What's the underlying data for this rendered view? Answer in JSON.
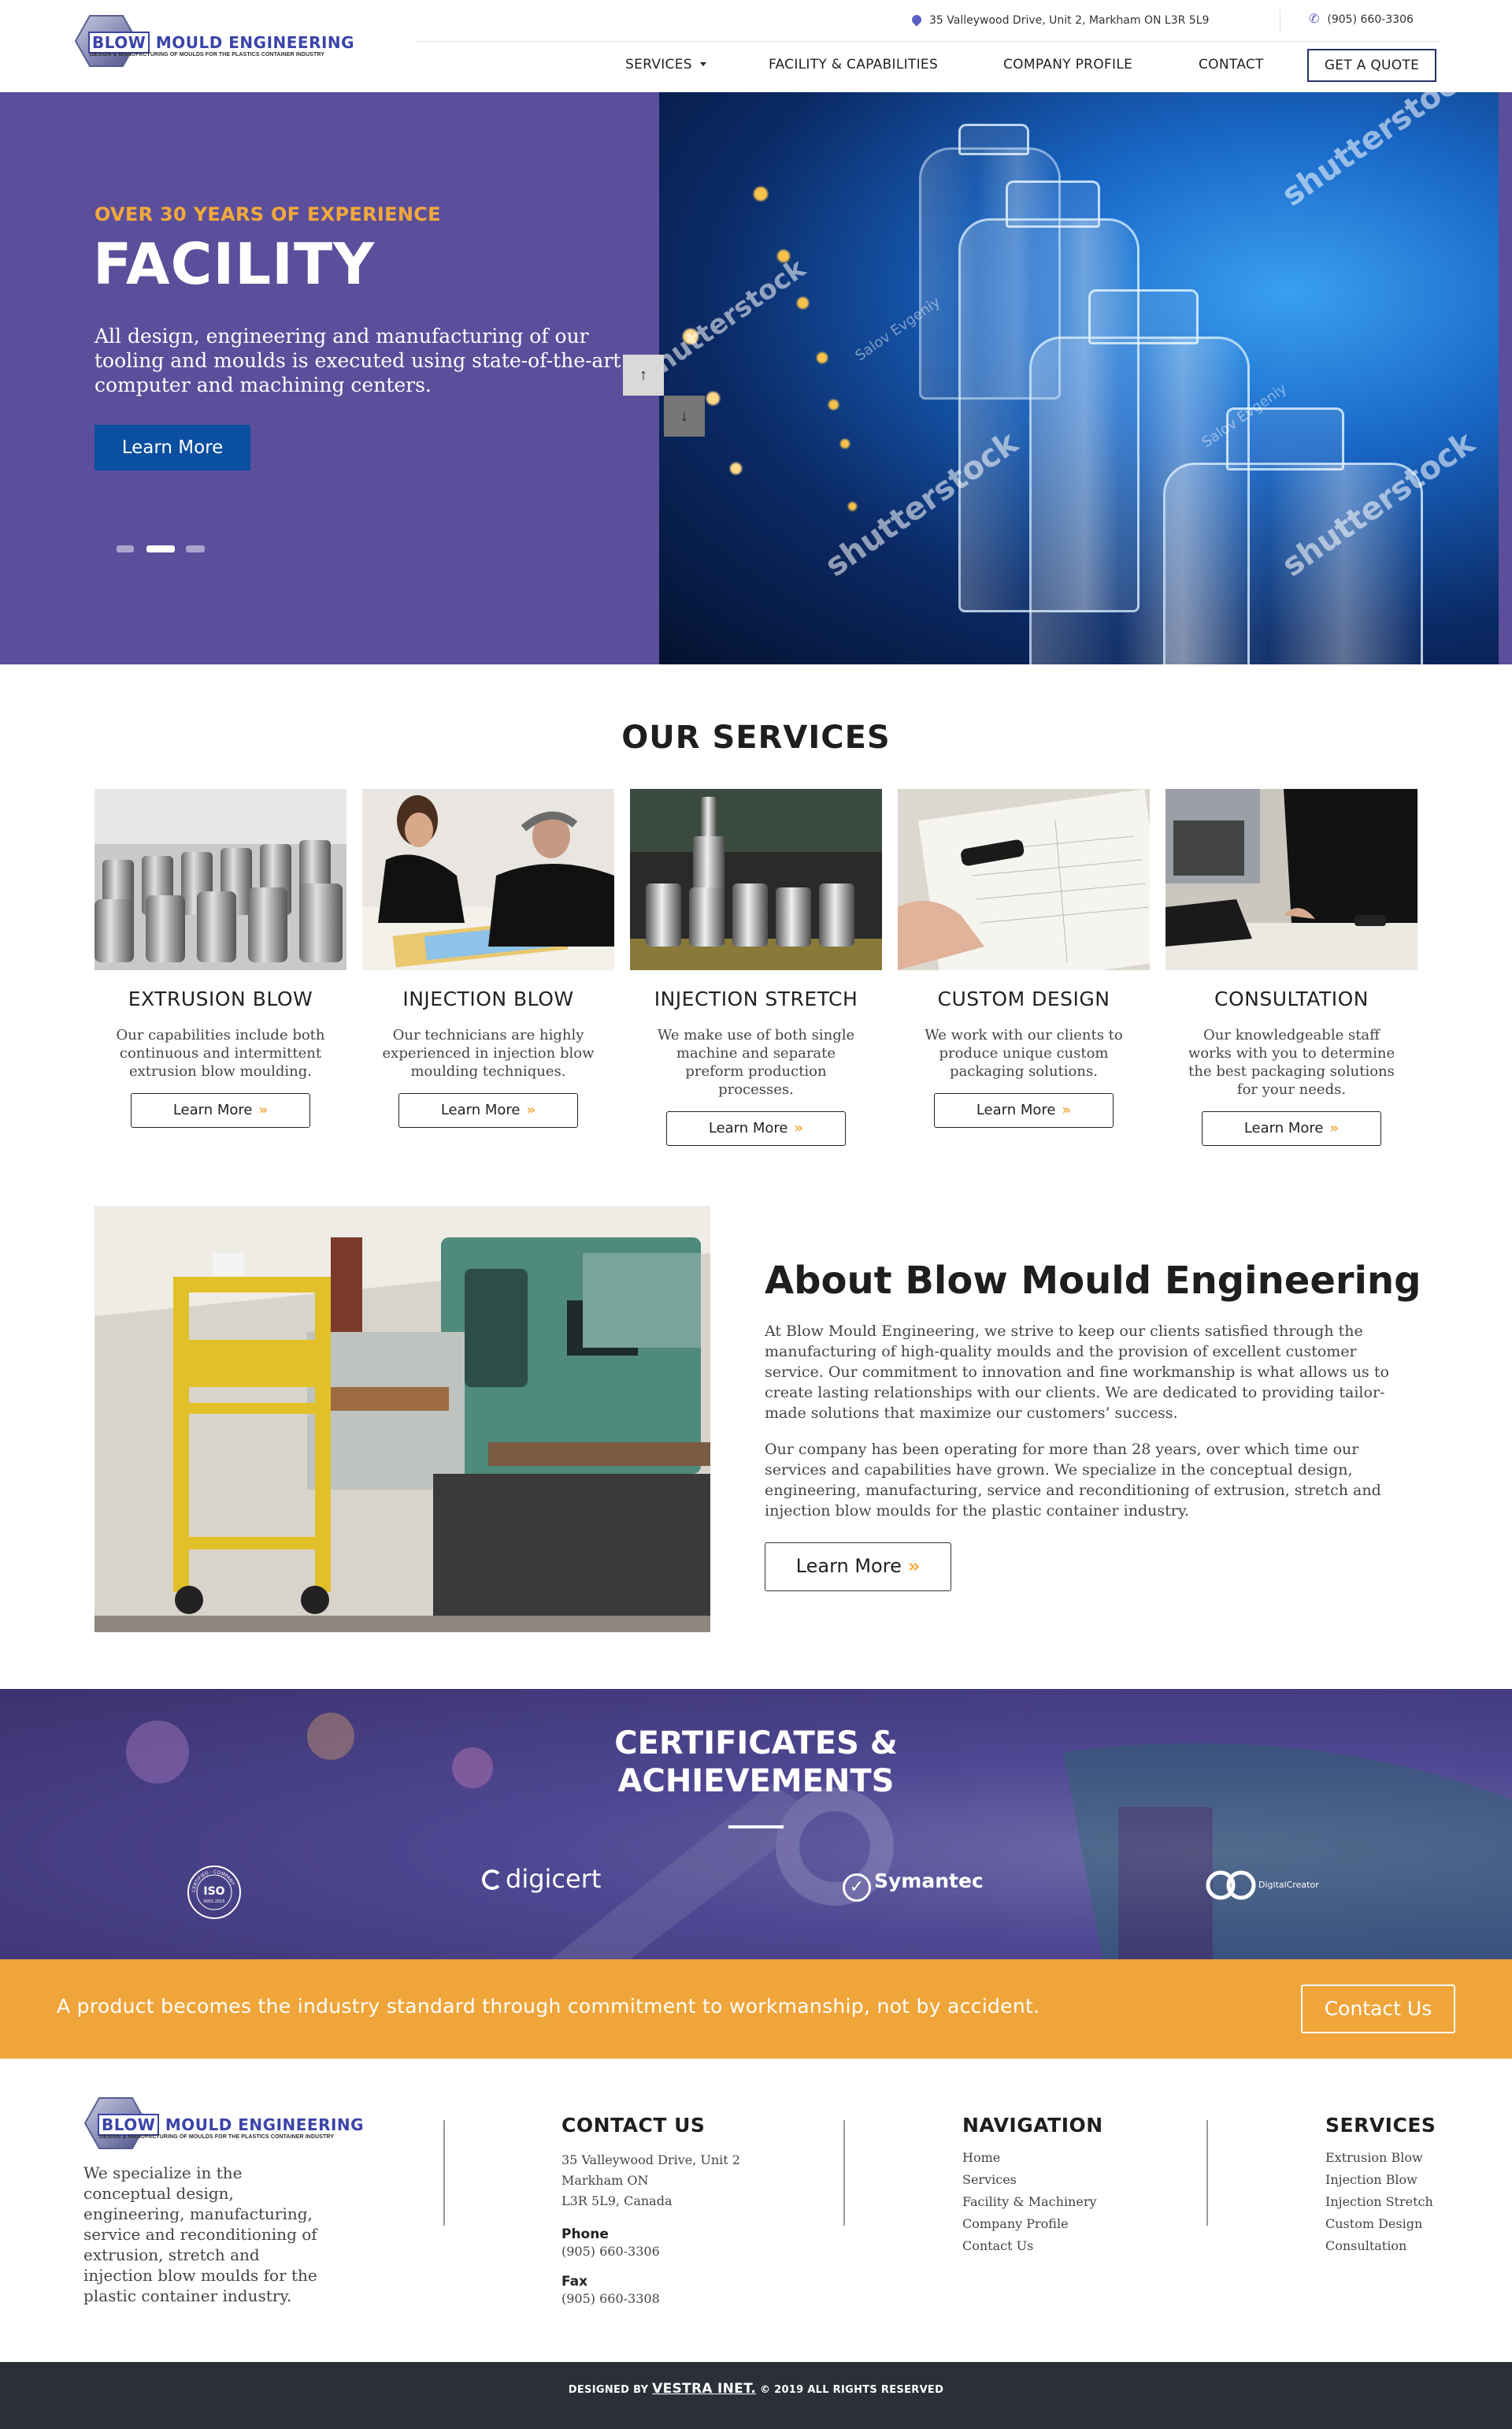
{
  "header": {
    "logo_name": "BLOW MOULD ENGINEERING",
    "logo_name_part1": "BLOW",
    "logo_name_part2": "MOULD ENGINEERING",
    "logo_tagline": "DESIGN & MANUFACTURING OF MOULDS FOR THE PLASTICS CONTAINER INDUSTRY",
    "address": "35 Valleywood Drive, Unit 2, Markham ON L3R 5L9",
    "phone": "(905) 660-3306",
    "nav": [
      "SERVICES",
      "FACILITY & CAPABILITIES",
      "COMPANY PROFILE",
      "CONTACT"
    ],
    "quote_label": "GET A QUOTE"
  },
  "hero": {
    "subtitle": "OVER 30 YEARS OF EXPERIENCE",
    "title": "FACILITY",
    "text": "All design, engineering and manufacturing of our tooling and moulds is executed using state-of-the-art computer and machining centers.",
    "button": "Learn More",
    "watermark": "shutterstock",
    "watermark_author": "Salov Evgeniy",
    "slides": 3,
    "active_slide": 2
  },
  "services": {
    "title": "OUR SERVICES",
    "items": [
      {
        "name": "EXTRUSION BLOW",
        "desc": "Our capabilities include both continuous and intermittent extrusion blow moulding.",
        "button": "Learn More"
      },
      {
        "name": "INJECTION BLOW",
        "desc": "Our technicians are highly experienced in injection blow moulding techniques.",
        "button": "Learn More"
      },
      {
        "name": "INJECTION STRETCH",
        "desc": "We make use of both single machine and separate preform production processes.",
        "button": "Learn More"
      },
      {
        "name": "CUSTOM DESIGN",
        "desc": "We work with our clients to produce unique custom packaging solutions.",
        "button": "Learn More"
      },
      {
        "name": "CONSULTATION",
        "desc": "Our knowledgeable staff works with you to determine the best packaging solutions for your needs.",
        "button": "Learn More"
      }
    ]
  },
  "about": {
    "title": "About Blow Mould Engineering",
    "p1": "At Blow Mould Engineering, we strive to keep our clients satisfied through the manufacturing of high-quality moulds and the provision of excellent customer service. Our commitment to innovation and fine workmanship is what allows us to create lasting relationships with our clients. We are dedicated to providing tailor-made solutions that maximize our customers’ success.",
    "p2": "Our company has been operating for more than 28 years, over which time our services and capabilities have grown. We specialize in the conceptual design, engineering, manufacturing, service and reconditioning of extrusion, stretch and injection blow moulds for the plastic container industry.",
    "button": "Learn More"
  },
  "certificates": {
    "title_line1": "CERTIFICATES &",
    "title_line2": "ACHIEVEMENTS",
    "logos": [
      "ISO",
      "digicert",
      "Symantec",
      "DigitalCreator"
    ],
    "iso_ring": "CERTIFIED · COMPANY",
    "iso_sub": "9001:2015"
  },
  "cta": {
    "text": "A product becomes the industry standard through commitment to workmanship, not by accident.",
    "button": "Contact Us"
  },
  "footer": {
    "desc": "We specialize in the conceptual design, engineering, manufacturing, service and reconditioning of extrusion, stretch and injection blow moulds for the plastic container industry.",
    "contact_title": "CONTACT US",
    "address_lines": [
      "35 Valleywood Drive, Unit 2",
      "Markham ON",
      "L3R 5L9, Canada"
    ],
    "phone_label": "Phone",
    "phone": "(905) 660-3306",
    "fax_label": "Fax",
    "fax": "(905) 660-3308",
    "nav_title": "NAVIGATION",
    "nav_links": [
      "Home",
      "Services",
      "Facility & Machinery",
      "Company Profile",
      "Contact Us"
    ],
    "services_title": "SERVICES",
    "service_links": [
      "Extrusion Blow",
      "Injection Blow",
      "Injection Stretch",
      "Custom Design",
      "Consultation"
    ]
  },
  "bottom_bar": {
    "prefix": "DESIGNED BY",
    "designer": "VESTRA INET.",
    "suffix": "© 2019 ALL RIGHTS RESERVED"
  },
  "colors": {
    "hero_purple": "#5b4f9b",
    "accent_orange": "#f0a53a",
    "button_blue": "#0b4fa0",
    "footer_dark": "#2b3038",
    "icon_purple": "#5a5fc5"
  }
}
